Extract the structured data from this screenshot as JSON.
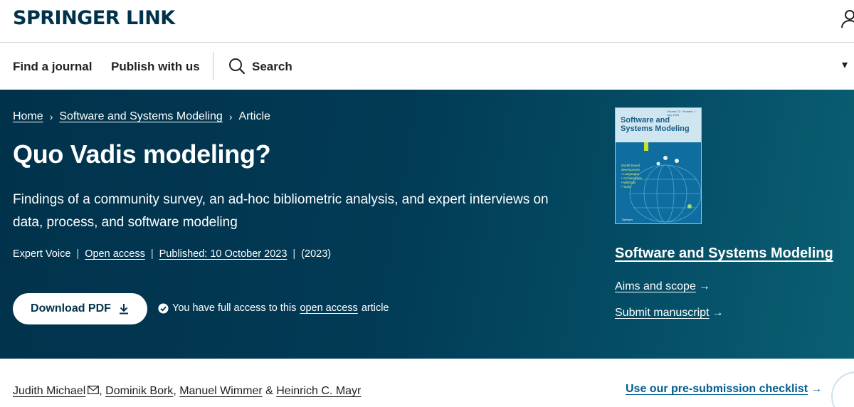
{
  "brand": {
    "logo_text": "SPRINGER LINK"
  },
  "nav": {
    "find_journal": "Find a journal",
    "publish": "Publish with us",
    "search": "Search"
  },
  "breadcrumb": {
    "home": "Home",
    "journal": "Software and Systems Modeling",
    "current": "Article"
  },
  "article": {
    "title": "Quo Vadis modeling?",
    "subtitle": "Findings of a community survey, an ad-hoc bibliometric analysis, and expert interviews on data, process, and software modeling",
    "type": "Expert Voice",
    "access": "Open access",
    "published": "Published: 10 October 2023",
    "year": "(2023)"
  },
  "actions": {
    "download_label": "Download PDF",
    "access_prefix": "You have full access to this",
    "access_link": "open access",
    "access_suffix": "article"
  },
  "journal": {
    "cover_volume": "Volume 22 · Number 1 · July 2023",
    "cover_title_1": "Software and",
    "cover_title_2": "Systems Modeling",
    "cover_lines": [
      "Model-based",
      "development",
      "• Languages",
      "• Architectures",
      "• Methods",
      "• Tools"
    ],
    "cover_publisher": "Springer",
    "name": "Software and Systems Modeling",
    "aims_label": "Aims and scope",
    "submit_label": "Submit manuscript"
  },
  "authors": {
    "list": [
      "Judith Michael",
      "Dominik Bork",
      "Manuel Wimmer",
      "Heinrich C. Mayr"
    ],
    "checklist": "Use our pre-submission checklist"
  },
  "colors": {
    "brand_navy": "#01324b",
    "link_blue": "#025e8d",
    "hero_teal": "#0a5f73"
  }
}
